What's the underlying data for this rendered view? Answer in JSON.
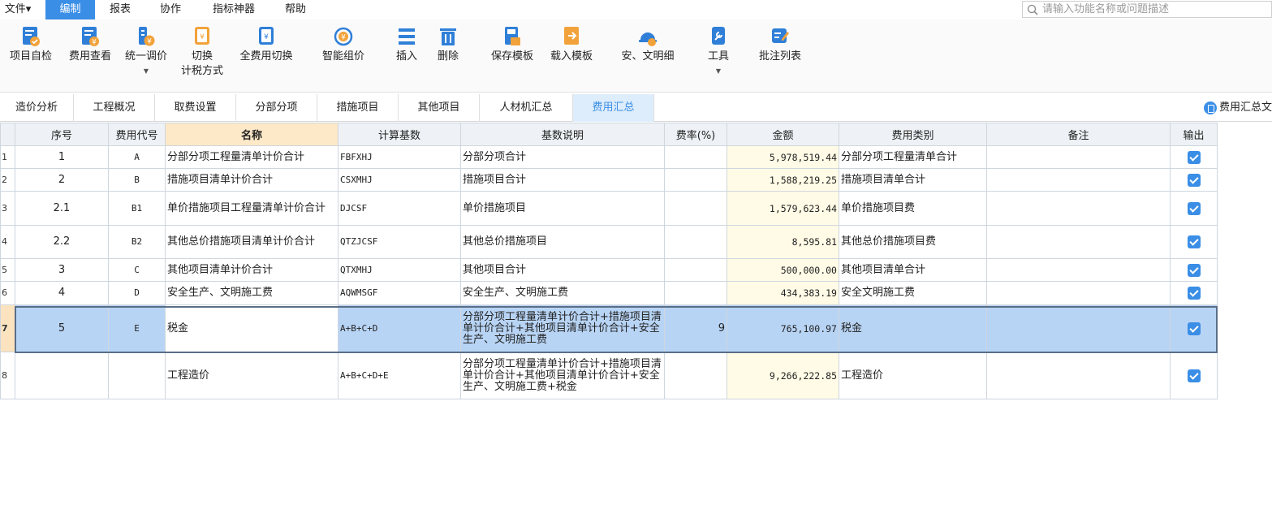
{
  "menu": {
    "items": [
      {
        "label": "文件▾"
      },
      {
        "label": "编制",
        "active": true
      },
      {
        "label": "报表"
      },
      {
        "label": "协作"
      },
      {
        "label": "指标神器"
      },
      {
        "label": "帮助"
      }
    ],
    "search_placeholder": "请输入功能名称或问题描述"
  },
  "ribbon": {
    "buttons": [
      {
        "label": "项目自检",
        "icon": "checklist-icon"
      },
      {
        "label": "费用查看",
        "icon": "cost-view-icon"
      },
      {
        "label": "统一调价",
        "icon": "price-adjust-icon"
      },
      {
        "label": "切换",
        "label2": "计税方式",
        "icon": "tax-switch-icon"
      },
      {
        "label": "全费用切换",
        "icon": "full-cost-switch-icon"
      },
      {
        "label": "智能组价",
        "icon": "smart-pricing-icon"
      },
      {
        "label": "插入",
        "icon": "insert-icon"
      },
      {
        "label": "删除",
        "icon": "delete-icon"
      },
      {
        "label": "保存模板",
        "icon": "save-template-icon"
      },
      {
        "label": "载入模板",
        "icon": "load-template-icon"
      },
      {
        "label": "安、文明细",
        "icon": "safety-helmet-icon"
      },
      {
        "label": "工具",
        "icon": "tools-icon"
      },
      {
        "label": "批注列表",
        "icon": "annotation-list-icon"
      }
    ]
  },
  "tabs": {
    "items": [
      {
        "label": "造价分析"
      },
      {
        "label": "工程概况"
      },
      {
        "label": "取费设置"
      },
      {
        "label": "分部分项"
      },
      {
        "label": "措施项目"
      },
      {
        "label": "其他项目"
      },
      {
        "label": "人材机汇总"
      },
      {
        "label": "费用汇总",
        "active": true
      }
    ],
    "right_label": "费用汇总文"
  },
  "grid": {
    "columns": [
      "序号",
      "费用代号",
      "名称",
      "计算基数",
      "基数说明",
      "费率(%)",
      "金额",
      "费用类别",
      "备注",
      "输出"
    ],
    "sorted_column": "名称",
    "rows": [
      {
        "n": "1",
        "seq": "1",
        "code": "A",
        "name": "分部分项工程量清单计价合计",
        "base": "FBFXHJ",
        "desc": "分部分项合计",
        "rate": "",
        "amount": "5,978,519.44",
        "category": "分部分项工程量清单合计",
        "note": "",
        "output": true
      },
      {
        "n": "2",
        "seq": "2",
        "code": "B",
        "name": "措施项目清单计价合计",
        "base": "CSXMHJ",
        "desc": "措施项目合计",
        "rate": "",
        "amount": "1,588,219.25",
        "category": "措施项目清单合计",
        "note": "",
        "output": true
      },
      {
        "n": "3",
        "seq": "2.1",
        "code": "B1",
        "name": "单价措施项目工程量清单计价合计",
        "base": "DJCSF",
        "desc": "单价措施项目",
        "rate": "",
        "amount": "1,579,623.44",
        "category": "单价措施项目费",
        "note": "",
        "output": true
      },
      {
        "n": "4",
        "seq": "2.2",
        "code": "B2",
        "name": "其他总价措施项目清单计价合计",
        "base": "QTZJCSF",
        "desc": "其他总价措施项目",
        "rate": "",
        "amount": "8,595.81",
        "category": "其他总价措施项目费",
        "note": "",
        "output": true
      },
      {
        "n": "5",
        "seq": "3",
        "code": "C",
        "name": "其他项目清单计价合计",
        "base": "QTXMHJ",
        "desc": "其他项目合计",
        "rate": "",
        "amount": "500,000.00",
        "category": "其他项目清单合计",
        "note": "",
        "output": true
      },
      {
        "n": "6",
        "seq": "4",
        "code": "D",
        "name": "安全生产、文明施工费",
        "base": "AQWMSGF",
        "desc": "安全生产、文明施工费",
        "rate": "",
        "amount": "434,383.19",
        "category": "安全文明施工费",
        "note": "",
        "output": true
      },
      {
        "n": "7",
        "seq": "5",
        "code": "E",
        "name": "税金",
        "base": "A+B+C+D",
        "desc": "分部分项工程量清单计价合计+措施项目清单计价合计+其他项目清单计价合计+安全生产、文明施工费",
        "rate": "9",
        "amount": "765,100.97",
        "category": "税金",
        "note": "",
        "output": true,
        "selected": true
      },
      {
        "n": "8",
        "seq": "",
        "code": "",
        "name": "工程造价",
        "base": "A+B+C+D+E",
        "desc": "分部分项工程量清单计价合计+措施项目清单计价合计+其他项目清单计价合计+安全生产、文明施工费+税金",
        "rate": "",
        "amount": "9,266,222.85",
        "category": "工程造价",
        "note": "",
        "output": true
      }
    ]
  }
}
